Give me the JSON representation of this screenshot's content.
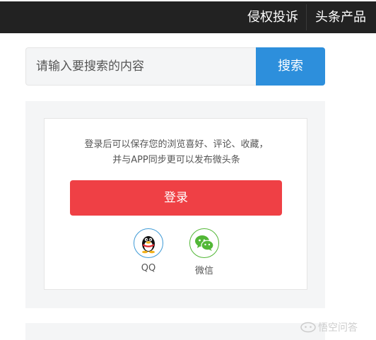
{
  "header": {
    "links": [
      "侵权投诉",
      "头条产品"
    ]
  },
  "search": {
    "placeholder": "请输入要搜索的内容",
    "button_label": "搜索"
  },
  "login_card": {
    "hint_line1": "登录后可以保存您的浏览喜好、评论、收藏，",
    "hint_line2": "并与APP同步更可以发布微头条",
    "login_label": "登录",
    "options": [
      {
        "label": "QQ",
        "icon": "qq-penguin-icon"
      },
      {
        "label": "微信",
        "icon": "wechat-icon"
      }
    ]
  },
  "watermark": {
    "text": "悟空问答"
  },
  "colors": {
    "topbar": "#222222",
    "search_button": "#2d8fdc",
    "login_button": "#ef4045",
    "qq": "#3e9ad6",
    "wechat": "#52b736",
    "panel_bg": "#f4f5f6"
  }
}
